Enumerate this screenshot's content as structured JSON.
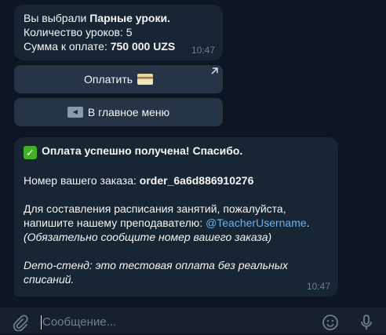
{
  "message1": {
    "line1_prefix": "Вы выбрали ",
    "line1_bold": "Парные уроки.",
    "line2": "Количество уроков: 5",
    "line3_prefix": "Сумма к оплате: ",
    "line3_bold": "750 000 UZS",
    "time": "10:47"
  },
  "buttons": {
    "pay_label": "Оплатить",
    "menu_label": "В главное меню"
  },
  "message2": {
    "success": "Оплата успешно получена! Спасибо.",
    "order_prefix": "Номер вашего заказа: ",
    "order_id": "order_6a6d886910276",
    "schedule_line1": "Для составления расписания занятий, пожалуйста,",
    "schedule_line2_prefix": "напишите нашему преподавателю: ",
    "teacher_link": "@TeacherUsername",
    "schedule_line2_suffix": ".",
    "note": "(Обязательно сообщите номер вашего заказа)",
    "demo_line1": "Demo-стенд: это тестовая оплата без реальных",
    "demo_line2": "списаний.",
    "time": "10:47"
  },
  "composer": {
    "placeholder": "Сообщение..."
  },
  "icons": [
    "paperclip-icon",
    "emoji-icon",
    "microphone-icon",
    "external-link-icon",
    "check-emoji-icon",
    "card-emoji-icon",
    "back-emoji-icon"
  ]
}
